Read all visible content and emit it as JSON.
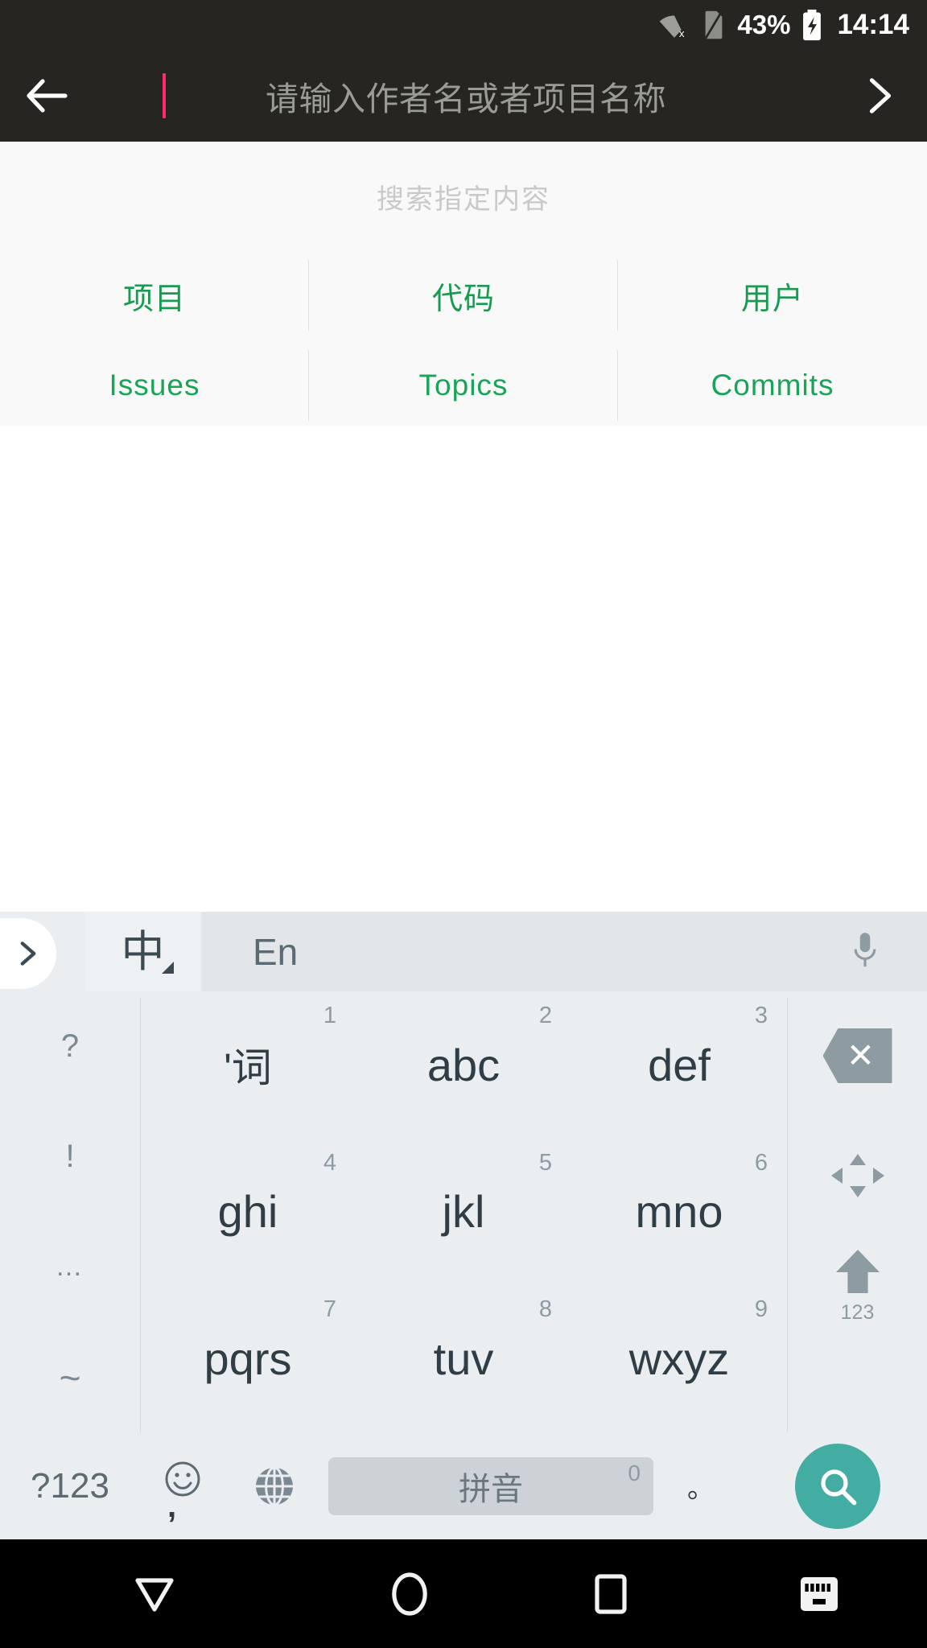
{
  "status_bar": {
    "wifi_icon": "wifi-off-icon",
    "sim_icon": "sim-card-missing-icon",
    "battery_percent": "43%",
    "battery_icon": "battery-charging-icon",
    "clock": "14:14"
  },
  "app_bar": {
    "back_icon": "arrow-left-icon",
    "search_placeholder": "请输入作者名或者项目名称",
    "search_value": "",
    "next_icon": "chevron-right-icon",
    "cursor_color": "#ff2d6f",
    "background": "#262522"
  },
  "panel": {
    "title": "搜索指定内容",
    "link_color": "#169b50",
    "background": "#f8f9f8",
    "rows": [
      [
        {
          "label": "项目",
          "name": "link-repositories",
          "cjk": true
        },
        {
          "label": "代码",
          "name": "link-code",
          "cjk": true
        },
        {
          "label": "用户",
          "name": "link-users",
          "cjk": true
        }
      ],
      [
        {
          "label": "Issues",
          "name": "link-issues",
          "cjk": false
        },
        {
          "label": "Topics",
          "name": "link-topics",
          "cjk": false
        },
        {
          "label": "Commits",
          "name": "link-commits",
          "cjk": false
        }
      ]
    ]
  },
  "keyboard": {
    "toolbar": {
      "expand_icon": "chevron-right-icon",
      "cn_label": "中",
      "en_label": "En",
      "mic_icon": "microphone-icon",
      "selected": "中"
    },
    "symbol_column": [
      "?",
      "!",
      "…",
      "~"
    ],
    "keys": [
      {
        "main": "'词",
        "num": "1",
        "cjk": true
      },
      {
        "main": "abc",
        "num": "2",
        "cjk": false
      },
      {
        "main": "def",
        "num": "3",
        "cjk": false
      },
      {
        "main": "ghi",
        "num": "4",
        "cjk": false
      },
      {
        "main": "jkl",
        "num": "5",
        "cjk": false
      },
      {
        "main": "mno",
        "num": "6",
        "cjk": false
      },
      {
        "main": "pqrs",
        "num": "7",
        "cjk": false
      },
      {
        "main": "tuv",
        "num": "8",
        "cjk": false
      },
      {
        "main": "wxyz",
        "num": "9",
        "cjk": false
      }
    ],
    "right_column": {
      "backspace_icon": "backspace-icon",
      "backspace_glyph": "✕",
      "cursor_icon": "four-way-arrow-icon",
      "shift_icon": "arrow-up-icon",
      "shift_sublabel": "123"
    },
    "bottom_row": {
      "symbols_label": "?123",
      "emoji_icon": "emoji-smiley-icon",
      "comma_label": ",",
      "globe_icon": "globe-language-icon",
      "space_label": "拼音",
      "space_superscript": "0",
      "period_label": "。",
      "search_icon": "magnifier-icon",
      "search_button_color": "#43aca3"
    }
  },
  "nav_bar": {
    "back_icon": "nav-back-triangle-icon",
    "home_icon": "nav-home-circle-icon",
    "recents_icon": "nav-recents-square-icon",
    "keyboard_icon": "hide-keyboard-icon",
    "background": "#000000"
  }
}
